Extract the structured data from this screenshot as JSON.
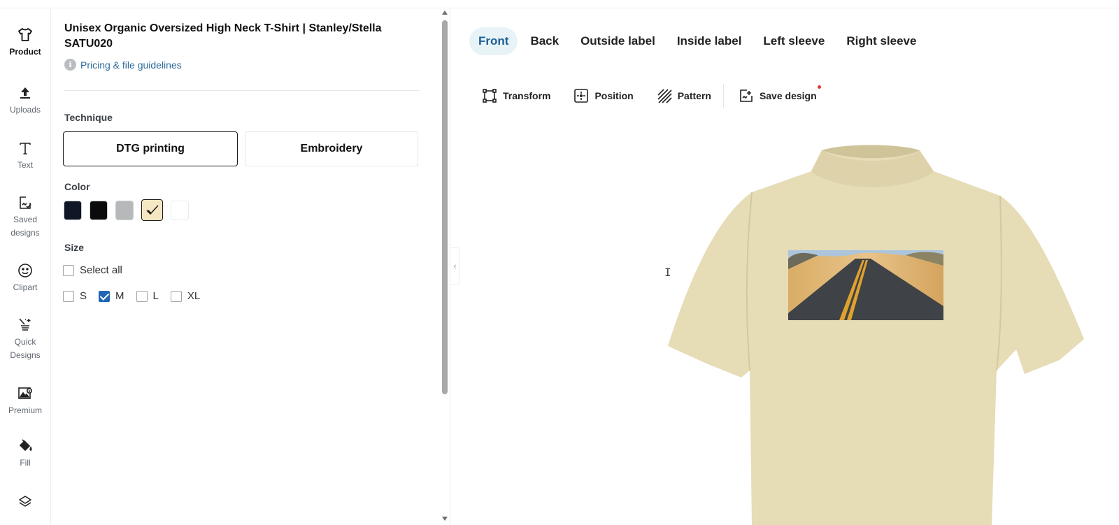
{
  "sidebar": {
    "items": [
      {
        "label": "Product",
        "icon": "tshirt-icon",
        "active": true
      },
      {
        "label": "Uploads",
        "icon": "upload-icon"
      },
      {
        "label": "Text",
        "icon": "text-icon"
      },
      {
        "label": "Saved\ndesigns",
        "icon": "saved-designs-icon"
      },
      {
        "label": "Clipart",
        "icon": "smiley-icon"
      },
      {
        "label": "Quick\nDesigns",
        "icon": "magic-wand-icon"
      },
      {
        "label": "Premium",
        "icon": "premium-image-icon"
      },
      {
        "label": "Fill",
        "icon": "paint-bucket-icon"
      },
      {
        "label": "",
        "icon": "layers-icon"
      }
    ]
  },
  "product": {
    "title": "Unisex Organic Oversized High Neck T-Shirt | Stanley/Stella SATU020",
    "guidelines_link": "Pricing & file guidelines"
  },
  "technique": {
    "label": "Technique",
    "options": [
      "DTG printing",
      "Embroidery"
    ],
    "selected": "DTG printing"
  },
  "color": {
    "label": "Color",
    "swatches": [
      {
        "name": "navy",
        "hex": "#0f1626"
      },
      {
        "name": "black",
        "hex": "#0b0b0b"
      },
      {
        "name": "heather-grey",
        "hex": "#b7b8b9"
      },
      {
        "name": "desert-dust",
        "hex": "#f4e7c2",
        "selected": true
      },
      {
        "name": "white",
        "hex": "#ffffff"
      }
    ]
  },
  "size": {
    "label": "Size",
    "select_all": "Select all",
    "options": [
      {
        "label": "S",
        "checked": false
      },
      {
        "label": "M",
        "checked": true
      },
      {
        "label": "L",
        "checked": false
      },
      {
        "label": "XL",
        "checked": false
      }
    ]
  },
  "views": {
    "tabs": [
      "Front",
      "Back",
      "Outside label",
      "Inside label",
      "Left sleeve",
      "Right sleeve"
    ],
    "active": "Front"
  },
  "toolbar": {
    "transform": "Transform",
    "position": "Position",
    "pattern": "Pattern",
    "save_design": "Save design"
  },
  "colors": {
    "accent": "#1c5f92",
    "tab_active_bg": "#e8f3f8",
    "link": "#2c6a9a",
    "checkbox": "#1f66b5",
    "shirt": "#e6dcb6",
    "notification": "#e8362c"
  }
}
